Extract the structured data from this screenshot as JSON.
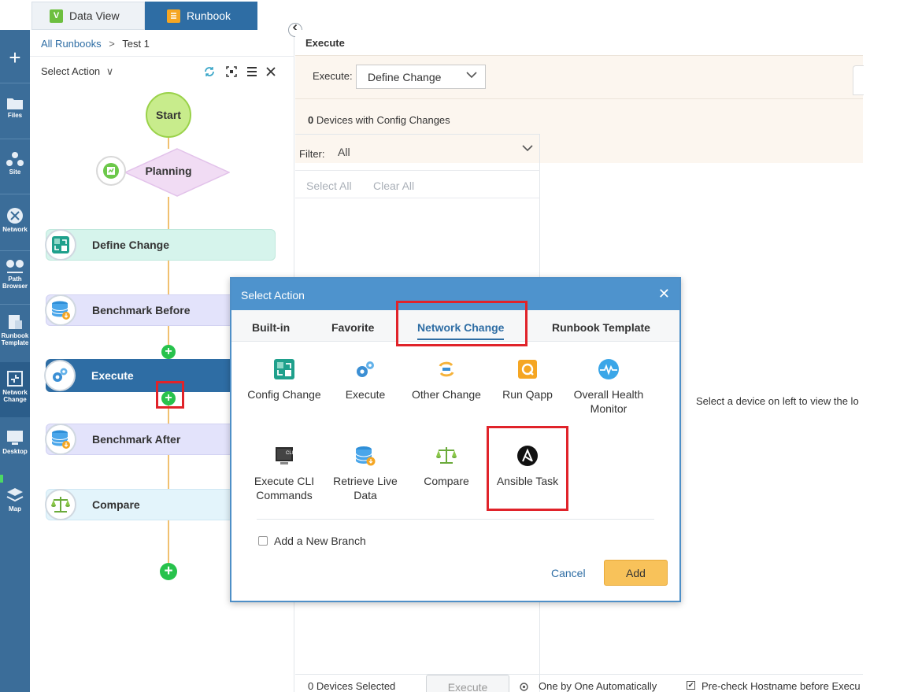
{
  "rail": {
    "add_label": "+",
    "items": [
      {
        "label": "Files"
      },
      {
        "label": "Site"
      },
      {
        "label": "Network"
      },
      {
        "label": "Path Browser"
      },
      {
        "label": "Runbook Template"
      },
      {
        "label": "Network Change"
      },
      {
        "label": "Desktop"
      },
      {
        "label": "Map"
      }
    ]
  },
  "tabs": {
    "data_view": "Data View",
    "data_view_icon_letter": "V",
    "runbook": "Runbook"
  },
  "breadcrumb": {
    "root": "All Runbooks",
    "separator": ">",
    "current": "Test 1"
  },
  "flow_toolbar": {
    "select_action": "Select Action",
    "chevron": "∨"
  },
  "flow": {
    "start": "Start",
    "planning": "Planning",
    "steps": [
      {
        "label": "Define Change"
      },
      {
        "label": "Benchmark Before"
      },
      {
        "label": "Execute"
      },
      {
        "label": "Benchmark After"
      },
      {
        "label": "Compare"
      }
    ],
    "add_symbol": "+"
  },
  "execute_pane": {
    "title": "Execute",
    "execute_label": "Execute:",
    "execute_select": "Define Change",
    "devices_count": "0",
    "devices_text": "Devices with Config Changes",
    "filter_label": "Filter:",
    "filter_value": "All",
    "select_all": "Select All",
    "clear_all": "Clear All",
    "empty_hint": "Select a device on left to view the lo",
    "bottom": {
      "devices_selected": "0 Devices Selected",
      "execute_button": "Execute",
      "one_by_one": "One by One Automatically",
      "precheck": "Pre-check Hostname before Execu"
    }
  },
  "modal": {
    "title": "Select Action",
    "close": "✕",
    "tabs": [
      "Built-in",
      "Favorite",
      "Network Change",
      "Runbook Template"
    ],
    "active_tab": "Network Change",
    "actions": [
      {
        "label": "Config Change",
        "icon": "config-change-icon"
      },
      {
        "label": "Execute",
        "icon": "gears-icon"
      },
      {
        "label": "Other Change",
        "icon": "other-change-icon"
      },
      {
        "label": "Run Qapp",
        "icon": "qapp-icon"
      },
      {
        "label": "Overall Health Monitor",
        "icon": "health-monitor-icon"
      },
      {
        "label": "Execute CLI Commands",
        "icon": "cli-icon"
      },
      {
        "label": "Retrieve Live Data",
        "icon": "database-icon"
      },
      {
        "label": "Compare",
        "icon": "scales-icon"
      },
      {
        "label": "Ansible Task",
        "icon": "ansible-icon"
      }
    ],
    "add_branch": "Add a New Branch",
    "cancel": "Cancel",
    "add": "Add"
  },
  "colors": {
    "rail": "#3b6d99",
    "accent": "#2e6da4",
    "highlight_red": "#e0232a",
    "add_button": "#f8c25a"
  }
}
